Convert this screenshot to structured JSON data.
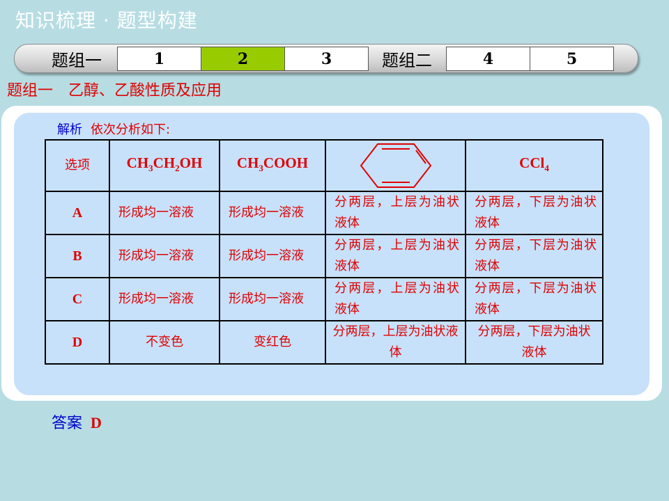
{
  "header": {
    "title": "知识梳理 · 题型构建"
  },
  "tabs": [
    {
      "label": "题组一",
      "kind": "group"
    },
    {
      "label": "1",
      "kind": "cell"
    },
    {
      "label": "2",
      "kind": "cell",
      "active": true
    },
    {
      "label": "3",
      "kind": "cell"
    },
    {
      "label": "题组二",
      "kind": "group"
    },
    {
      "label": "4",
      "kind": "cell"
    },
    {
      "label": "5",
      "kind": "cell"
    }
  ],
  "section": {
    "group": "题组一",
    "topic": "乙醇、乙酸性质及应用"
  },
  "analysis": {
    "label": "解析",
    "text": "依次分析如下:"
  },
  "table": {
    "header": {
      "option": "选项",
      "c1": {
        "base1": "CH",
        "sub1": "3",
        "base2": "CH",
        "sub2": "2",
        "base3": "OH"
      },
      "c2": {
        "base1": "CH",
        "sub1": "3",
        "base2": "COOH"
      },
      "c3_icon": "benzene-ring-icon",
      "c4": {
        "base1": "CCl",
        "sub1": "4"
      }
    },
    "rows": [
      {
        "option": "A",
        "c1": "形成均一溶液",
        "c2": "形成均一溶液",
        "c3": "分两层，上层为油状液体",
        "c4": "分两层，下层为油状液体"
      },
      {
        "option": "B",
        "c1": "形成均一溶液",
        "c2": "形成均一溶液",
        "c3": "分两层，上层为油状液体",
        "c4": "分两层，下层为油状液体"
      },
      {
        "option": "C",
        "c1": "形成均一溶液",
        "c2": "形成均一溶液",
        "c3": "分两层，上层为油状液体",
        "c4": "分两层，下层为油状液体"
      },
      {
        "option": "D",
        "c1": "不变色",
        "c2": "变红色",
        "c3": "分两层，上层为油状液体",
        "c4": "分两层，下层为油状液体"
      }
    ]
  },
  "answer": {
    "label": "答案",
    "value": "D"
  },
  "colors": {
    "background": "#b7dde3",
    "panel": "#c8e1fa",
    "accent_red": "#e00000",
    "accent_blue": "#0000cc",
    "active_tab": "#99cc00"
  }
}
